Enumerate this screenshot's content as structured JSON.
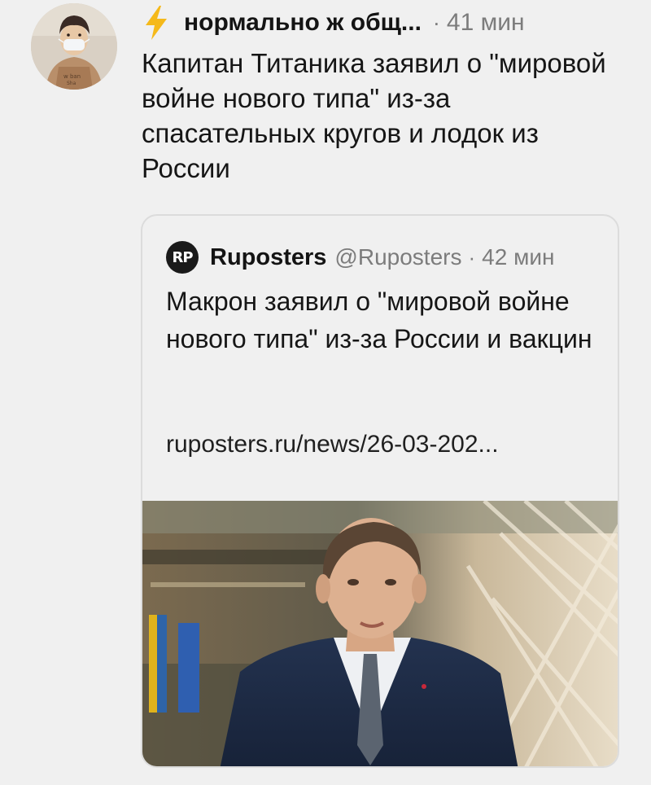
{
  "tweet": {
    "author": "нормально ж общ...",
    "separator": "·",
    "time": "41 мин",
    "text": "Капитан Титаника заявил о \"мировой войне нового типа\" из-за спасательных кругов и лодок из России",
    "avatar_icon": "user-avatar",
    "badge_icon": "lightning-bolt-icon"
  },
  "quoted": {
    "logo_text": "RP",
    "name": "Ruposters",
    "handle": "@Ruposters",
    "separator": "·",
    "time": "42 мин",
    "text": "Макрон заявил о \"мировой войне нового типа\" из-за России и вакцин",
    "link": "ruposters.ru/news/26-03-202...",
    "image_icon": "news-photo"
  },
  "colors": {
    "background": "#f0f0f0",
    "text": "#161616",
    "muted": "#7c7c7c",
    "bolt": "#f5b91a",
    "border": "#dcdcdc"
  }
}
